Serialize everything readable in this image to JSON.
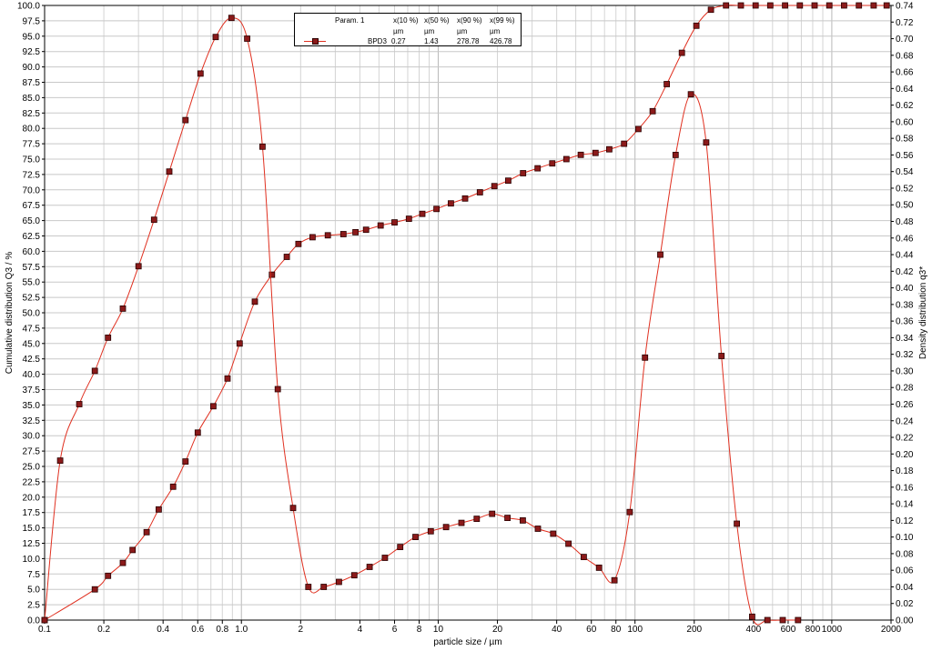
{
  "chart_data": {
    "type": "line",
    "xscale": "log",
    "xlim": [
      0.1,
      2000
    ],
    "x_tick_labels": [
      "0.1",
      "0.2",
      "0.4",
      "0.6",
      "0.8",
      "1.0",
      "2",
      "4",
      "6",
      "8",
      "10",
      "20",
      "40",
      "60",
      "80",
      "100",
      "200",
      "400",
      "600",
      "800",
      "1000",
      "2000"
    ],
    "x_tick_values": [
      0.1,
      0.2,
      0.4,
      0.6,
      0.8,
      1.0,
      2,
      4,
      6,
      8,
      10,
      20,
      40,
      60,
      80,
      100,
      200,
      400,
      600,
      800,
      1000,
      2000
    ],
    "xlabel": "particle size / µm",
    "ylabel": "Cumulative distribution Q3 / %",
    "ylim": [
      0,
      100
    ],
    "y_tick_labels": [
      "0.0",
      "2.5",
      "5.0",
      "7.5",
      "10.0",
      "12.5",
      "15.0",
      "17.5",
      "20.0",
      "22.5",
      "25.0",
      "27.5",
      "30.0",
      "32.5",
      "35.0",
      "37.5",
      "40.0",
      "42.5",
      "45.0",
      "47.5",
      "50.0",
      "52.5",
      "55.0",
      "57.5",
      "60.0",
      "62.5",
      "65.0",
      "67.5",
      "70.0",
      "72.5",
      "75.0",
      "77.5",
      "80.0",
      "82.5",
      "85.0",
      "87.5",
      "90.0",
      "92.5",
      "95.0",
      "97.5",
      "100.0"
    ],
    "y2label": "Density distribution q3*",
    "y2lim": [
      0,
      0.74
    ],
    "y2_tick_labels": [
      "0.00",
      "0.02",
      "0.04",
      "0.06",
      "0.08",
      "0.10",
      "0.12",
      "0.14",
      "0.16",
      "0.18",
      "0.20",
      "0.22",
      "0.24",
      "0.26",
      "0.28",
      "0.30",
      "0.32",
      "0.34",
      "0.36",
      "0.38",
      "0.40",
      "0.42",
      "0.44",
      "0.46",
      "0.48",
      "0.50",
      "0.52",
      "0.54",
      "0.56",
      "0.58",
      "0.60",
      "0.62",
      "0.64",
      "0.66",
      "0.68",
      "0.70",
      "0.72",
      "0.74"
    ],
    "grid": true,
    "legend_position": "top-center",
    "series": [
      {
        "name": "BPD3",
        "axis": "left",
        "color": "#e03020",
        "marker_color": "#8b1a1a",
        "x": [
          0.1,
          0.18,
          0.21,
          0.25,
          0.28,
          0.33,
          0.38,
          0.45,
          0.52,
          0.6,
          0.72,
          0.85,
          0.98,
          1.17,
          1.43,
          1.7,
          1.95,
          2.3,
          2.75,
          3.3,
          3.8,
          4.3,
          5.1,
          6.0,
          7.1,
          8.3,
          9.8,
          11.6,
          13.7,
          16.3,
          19.3,
          22.7,
          27.0,
          32.0,
          38.0,
          44.8,
          53.0,
          63.0,
          74.0,
          88.0,
          104.0,
          123.0,
          145.0,
          173.0,
          205.0,
          243.0,
          290.0,
          345.0,
          410.0,
          487.0,
          579.0,
          688.0,
          818.0,
          972.0,
          1155.0,
          1373.0,
          1632.0,
          1900.0
        ],
        "y": [
          0,
          5.0,
          7.2,
          9.3,
          11.4,
          14.3,
          18.0,
          21.7,
          25.8,
          30.5,
          34.8,
          39.3,
          45.0,
          51.8,
          56.2,
          59.1,
          61.2,
          62.3,
          62.6,
          62.8,
          63.1,
          63.5,
          64.2,
          64.7,
          65.3,
          66.1,
          66.9,
          67.8,
          68.6,
          69.6,
          70.6,
          71.5,
          72.7,
          73.5,
          74.3,
          75.0,
          75.7,
          76.0,
          76.6,
          77.5,
          79.9,
          82.8,
          87.2,
          92.3,
          96.7,
          99.3,
          100.0,
          100.0,
          100.0,
          100.0,
          100.0,
          100.0,
          100.0,
          100.0,
          100.0,
          100.0,
          100.0,
          100.0
        ]
      },
      {
        "name": "BPD3",
        "axis": "right",
        "color": "#e03020",
        "marker_color": "#8b1a1a",
        "x": [
          0.1,
          0.12,
          0.15,
          0.18,
          0.21,
          0.25,
          0.3,
          0.36,
          0.43,
          0.52,
          0.62,
          0.74,
          0.89,
          1.07,
          1.28,
          1.53,
          1.83,
          2.19,
          2.62,
          3.13,
          3.75,
          4.48,
          5.36,
          6.41,
          7.67,
          9.17,
          10.97,
          13.12,
          15.7,
          18.8,
          22.5,
          26.9,
          32.1,
          38.4,
          45.9,
          54.9,
          65.7,
          78.6,
          94.0,
          112.4,
          134.5,
          160.8,
          192.4,
          230.1,
          275.2,
          329.2,
          393.7,
          470.9,
          563.3,
          673.8
        ],
        "y": [
          0.0,
          0.192,
          0.26,
          0.3,
          0.34,
          0.375,
          0.426,
          0.482,
          0.54,
          0.602,
          0.658,
          0.702,
          0.725,
          0.7,
          0.57,
          0.278,
          0.135,
          0.04,
          0.04,
          0.046,
          0.054,
          0.064,
          0.075,
          0.088,
          0.1,
          0.107,
          0.112,
          0.117,
          0.122,
          0.128,
          0.123,
          0.12,
          0.11,
          0.104,
          0.092,
          0.076,
          0.063,
          0.048,
          0.13,
          0.316,
          0.44,
          0.56,
          0.633,
          0.575,
          0.318,
          0.116,
          0.004,
          0.0,
          0.0,
          0.0
        ]
      }
    ]
  },
  "legend": {
    "header": "Param. 1",
    "columns": [
      "x(10 %)",
      "x(50 %)",
      "x(90 %)",
      "x(99 %)"
    ],
    "units": [
      "µm",
      "µm",
      "µm",
      "µm"
    ],
    "row_label": "BPD3",
    "row_values": [
      "0.27",
      "1.43",
      "278.78",
      "426.78"
    ]
  }
}
